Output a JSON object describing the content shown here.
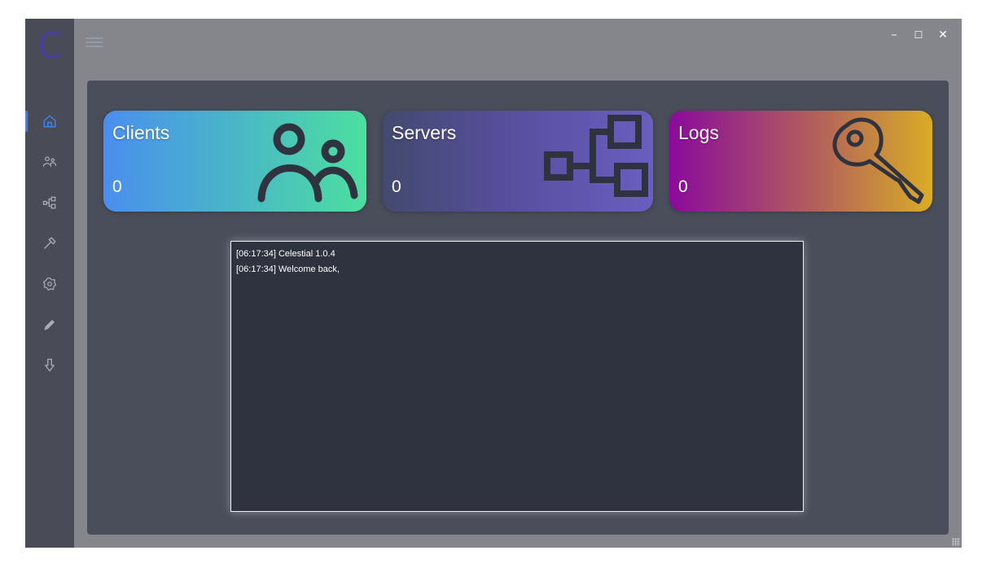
{
  "window": {
    "controls": {
      "minimize": "–",
      "maximize": "☐",
      "close": "✕"
    }
  },
  "sidebar": {
    "logo_letter": "C",
    "items": [
      {
        "id": "home",
        "icon": "home-icon",
        "active": true
      },
      {
        "id": "clients",
        "icon": "users-icon",
        "active": false
      },
      {
        "id": "servers",
        "icon": "network-icon",
        "active": false
      },
      {
        "id": "builder",
        "icon": "hammer-icon",
        "active": false
      },
      {
        "id": "settings",
        "icon": "settings-icon",
        "active": false
      },
      {
        "id": "edit",
        "icon": "pencil-icon",
        "active": false
      },
      {
        "id": "download",
        "icon": "download-icon",
        "active": false
      }
    ],
    "active_color": "#3b82f6",
    "icon_color": "#a9acb5"
  },
  "cards": {
    "clients": {
      "title": "Clients",
      "value": "0",
      "icon": "users-icon"
    },
    "servers": {
      "title": "Servers",
      "value": "0",
      "icon": "network-icon"
    },
    "logs": {
      "title": "Logs",
      "value": "0",
      "icon": "key-icon"
    }
  },
  "console": {
    "lines": [
      "[06:17:34] Celestial 1.0.4",
      "[06:17:34] Welcome back,"
    ]
  }
}
